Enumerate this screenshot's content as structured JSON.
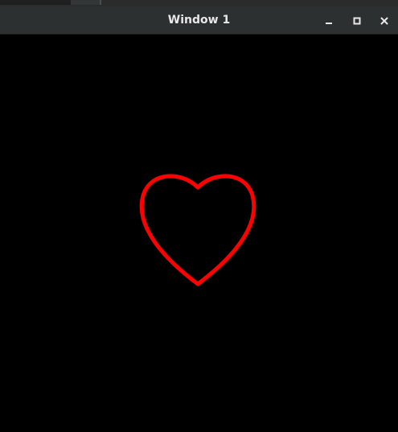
{
  "window": {
    "title": "Window 1",
    "buttons": {
      "minimize_icon": "minimize-icon",
      "maximize_icon": "maximize-icon",
      "close_icon": "close-icon"
    }
  },
  "canvas": {
    "background": "#000000",
    "shape": "heart",
    "stroke_color": "#ff0000",
    "fill": "none"
  },
  "colors": {
    "titlebar": "#2d3030",
    "title_text": "#e8e8e8"
  }
}
